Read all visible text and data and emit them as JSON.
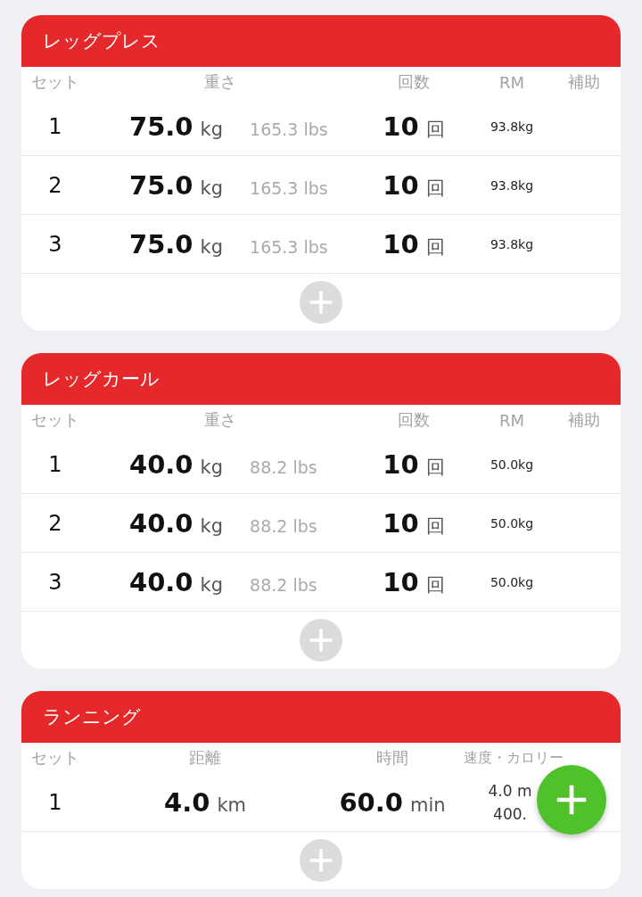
{
  "exercises": [
    {
      "kind": "strength",
      "title": "レッグプレス",
      "columns": [
        "セット",
        "重さ",
        "回数",
        "RM",
        "補助"
      ],
      "sets": [
        {
          "set": "1",
          "weight": "75.0",
          "weight_unit": "kg",
          "lbs": "165.3 lbs",
          "reps": "10",
          "reps_unit": "回",
          "rm": "93.8kg"
        },
        {
          "set": "2",
          "weight": "75.0",
          "weight_unit": "kg",
          "lbs": "165.3 lbs",
          "reps": "10",
          "reps_unit": "回",
          "rm": "93.8kg"
        },
        {
          "set": "3",
          "weight": "75.0",
          "weight_unit": "kg",
          "lbs": "165.3 lbs",
          "reps": "10",
          "reps_unit": "回",
          "rm": "93.8kg"
        }
      ]
    },
    {
      "kind": "strength",
      "title": "レッグカール",
      "columns": [
        "セット",
        "重さ",
        "回数",
        "RM",
        "補助"
      ],
      "sets": [
        {
          "set": "1",
          "weight": "40.0",
          "weight_unit": "kg",
          "lbs": "88.2 lbs",
          "reps": "10",
          "reps_unit": "回",
          "rm": "50.0kg"
        },
        {
          "set": "2",
          "weight": "40.0",
          "weight_unit": "kg",
          "lbs": "88.2 lbs",
          "reps": "10",
          "reps_unit": "回",
          "rm": "50.0kg"
        },
        {
          "set": "3",
          "weight": "40.0",
          "weight_unit": "kg",
          "lbs": "88.2 lbs",
          "reps": "10",
          "reps_unit": "回",
          "rm": "50.0kg"
        }
      ]
    },
    {
      "kind": "cardio",
      "title": "ランニング",
      "columns": [
        "セット",
        "距離",
        "時間",
        "速度・カロリー"
      ],
      "sets": [
        {
          "set": "1",
          "distance": "4.0",
          "distance_unit": "km",
          "time": "60.0",
          "time_unit": "min",
          "speed": "4.0 m",
          "calories": "400."
        }
      ]
    }
  ]
}
